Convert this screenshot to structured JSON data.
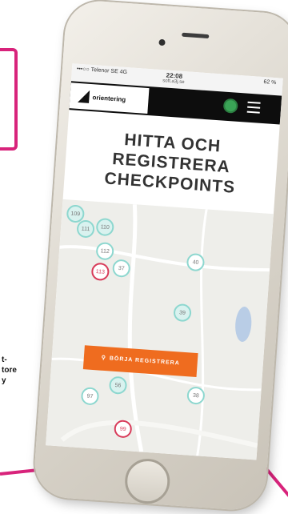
{
  "background": {
    "side_text": "t-\ntore\ny"
  },
  "status_bar": {
    "carrier": "•••○○ Telenor SE  4G",
    "time": "22:08",
    "url": "soft.a3j.se",
    "battery": "62 %"
  },
  "header": {
    "logo_text": "orientering",
    "avatar_color": "#3aa356"
  },
  "hero": {
    "line1": "HITTA OCH",
    "line2": "REGISTRERA",
    "line3": "CHECKPOINTS"
  },
  "map": {
    "pins": [
      "109",
      "111",
      "110",
      "112",
      "113",
      "37",
      "40",
      "39",
      "56",
      "38",
      "97",
      "99"
    ]
  },
  "cta": {
    "label": "BÖRJA REGISTRERA",
    "color": "#ef6c1f"
  }
}
